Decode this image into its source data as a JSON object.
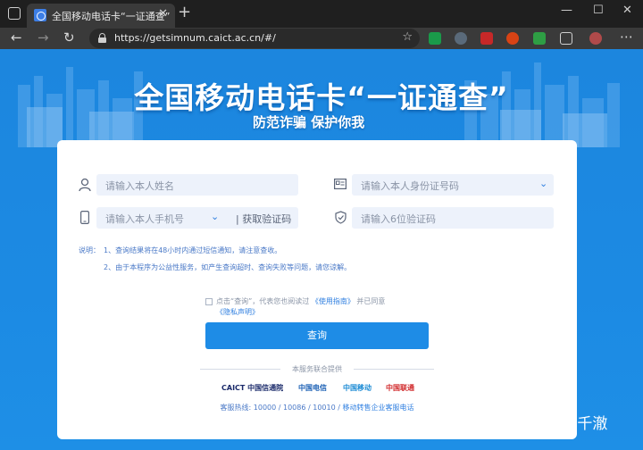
{
  "browser": {
    "tab_title": "全国移动电话卡“一证通查”",
    "tab_close": "✕",
    "new_tab": "+",
    "url": "https://getsimnum.caict.ac.cn/#/",
    "window_controls": [
      "—",
      "☐",
      "✕"
    ],
    "nav_icons": [
      "back-icon",
      "forward-icon",
      "reload-icon"
    ]
  },
  "hero": {
    "title": "全国移动电话卡“一证通查”",
    "subtitle": "防范诈骗 保护你我"
  },
  "form": {
    "name_placeholder": "请输入本人姓名",
    "id_placeholder": "请输入本人身份证号码",
    "phone_placeholder": "请输入本人手机号",
    "get_code": "| 获取验证码",
    "code_placeholder": "请输入6位验证码"
  },
  "notes": {
    "label": "说明：",
    "item1": "1、查询结果将在48小时内通过短信通知，请注意查收。",
    "item2": "2、由于本程序为公益性服务，如产生查询超时、查询失败等问题，请您谅解。"
  },
  "agreement": {
    "prefix": "点击“查询”，代表您也阅读过",
    "guide_link": "《使用指南》",
    "middle": "并已同意",
    "privacy_link": "《隐私声明》"
  },
  "submit_label": "查询",
  "providers": {
    "heading": "本服务联合提供",
    "logos": [
      "CAICT 中国信通院",
      "中国电信",
      "中国移动",
      "中国联通"
    ]
  },
  "hotline": {
    "text": "客服热线: 10000 / 10086 / 10010 / ",
    "link": "移动转售企业客服电话"
  },
  "watermark": "知乎 @千澈",
  "colors": {
    "accent": "#1e8ce6",
    "page_bg": "#1c86de",
    "field_bg": "#edf2fb"
  }
}
